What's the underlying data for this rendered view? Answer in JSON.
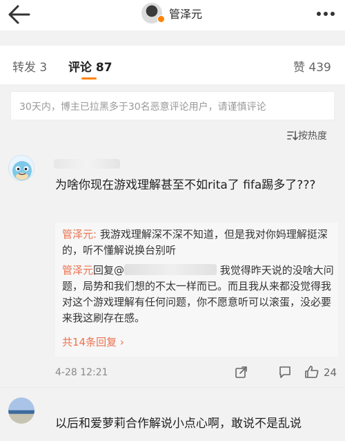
{
  "header": {
    "title": "管泽元"
  },
  "tabs": {
    "repost": "转发 3",
    "comment": "评论 87",
    "like": "赞 439"
  },
  "notice": "30天内，博主已拉黑多于30名恶意评论用户，请谨慎评论",
  "sort": "按热度",
  "comments": [
    {
      "text": "为啥你现在游戏理解甚至不如rita了 fifa踢多了???",
      "replies": [
        {
          "author": "管泽元:",
          "text": " 我游戏理解深不深不知道，但是我对你妈理解挺深的，听不懂解说换台别听"
        },
        {
          "author": "管泽元",
          "verb": "回复@",
          "text": " 我觉得昨天说的没啥大问题，局势和我们想的不太一样而已。而且我从来都没觉得我对这个游戏理解有任何问题，你不愿意听可以滚蛋，没必要来我这刷存在感。"
        }
      ],
      "more_replies": "共14条回复 ›",
      "time": "4-28 12:21",
      "likes": "24"
    },
    {
      "text": "以后和爱萝莉合作解说小点心啊，敢说不是乱说"
    }
  ],
  "colors": {
    "accent": "#ff8200",
    "link": "#eb7350"
  }
}
